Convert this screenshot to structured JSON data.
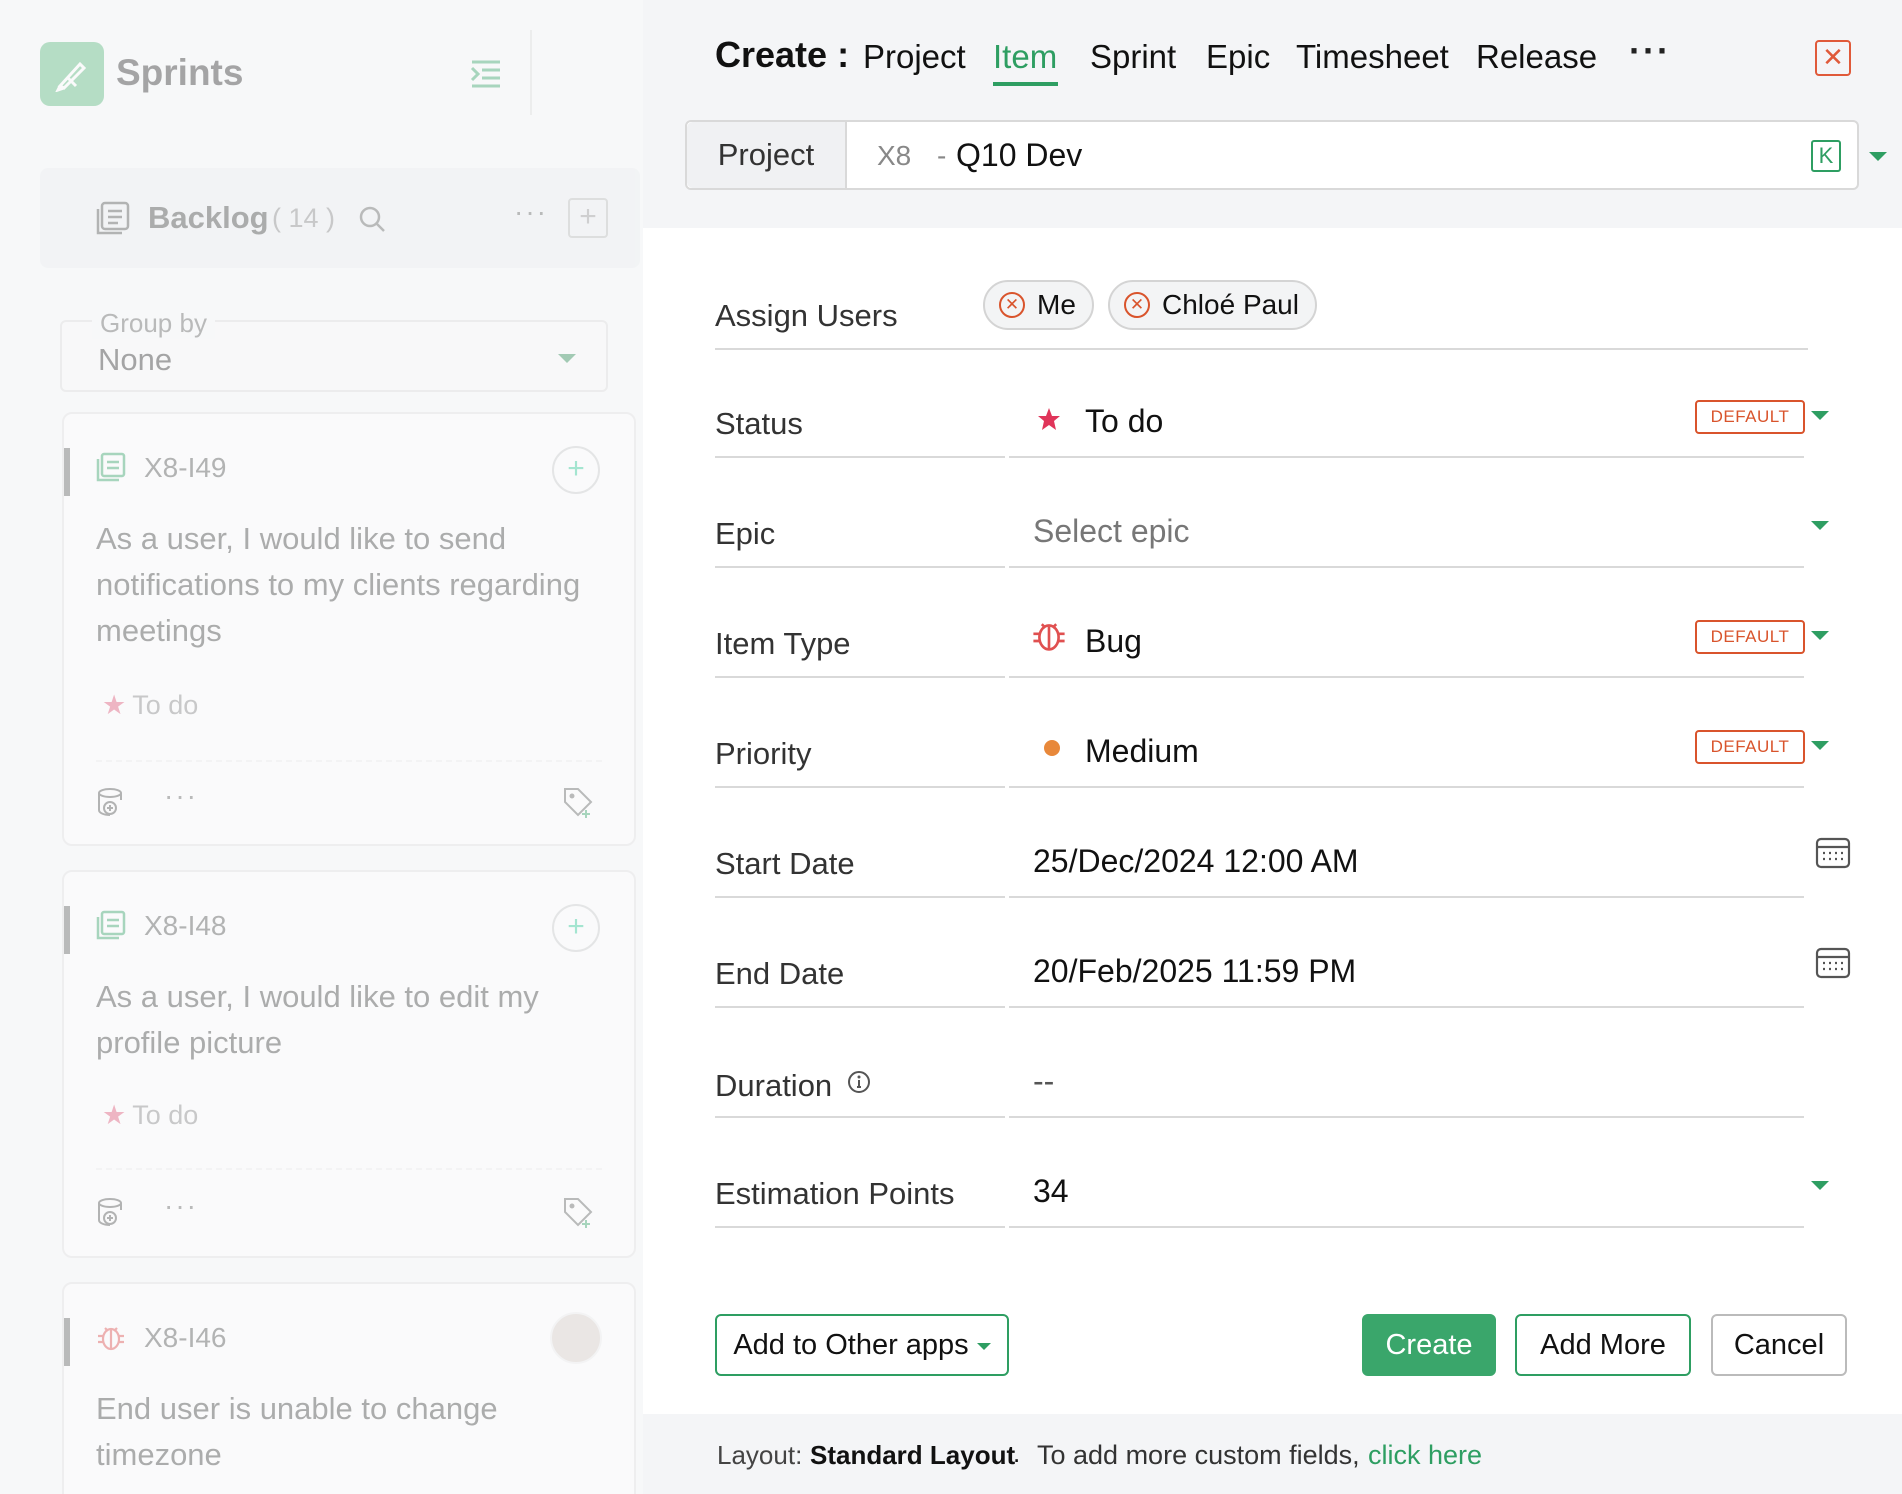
{
  "sidebar": {
    "title": "Sprints",
    "backlog": {
      "title": "Backlog",
      "count": "( 14 )",
      "more": "···",
      "add": "+"
    },
    "group_by": {
      "label": "Group by",
      "value": "None"
    },
    "cards": [
      {
        "id": "X8-I49",
        "text": "As a user, I would like to send notifications to my clients regarding meetings",
        "status": "To do",
        "more": "···"
      },
      {
        "id": "X8-I48",
        "text": "As a user, I would like to edit my profile picture",
        "status": "To do",
        "more": "···"
      },
      {
        "id": "X8-I46",
        "text": "End user is unable to change timezone"
      }
    ]
  },
  "panel": {
    "create_label": "Create :",
    "tabs": [
      "Project",
      "Item",
      "Sprint",
      "Epic",
      "Timesheet",
      "Release"
    ],
    "active_tab": "Item",
    "more": "···",
    "close": "✕",
    "project": {
      "label": "Project",
      "code": "X8",
      "dash": "-",
      "name": "Q10 Dev",
      "k_badge": "K"
    },
    "fields": {
      "assign_users": {
        "label": "Assign Users",
        "users": [
          "Me",
          "Chloé Paul"
        ]
      },
      "status": {
        "label": "Status",
        "value": "To do",
        "badge": "DEFAULT",
        "color": "#e0355a"
      },
      "epic": {
        "label": "Epic",
        "placeholder": "Select epic"
      },
      "item_type": {
        "label": "Item Type",
        "value": "Bug",
        "badge": "DEFAULT",
        "color": "#e05050"
      },
      "priority": {
        "label": "Priority",
        "value": "Medium",
        "badge": "DEFAULT",
        "color": "#e8883a"
      },
      "start_date": {
        "label": "Start Date",
        "value": "25/Dec/2024 12:00 AM"
      },
      "end_date": {
        "label": "End Date",
        "value": "20/Feb/2025 11:59 PM"
      },
      "duration": {
        "label": "Duration",
        "value": "--"
      },
      "estimation_points": {
        "label": "Estimation Points",
        "value": "34"
      }
    },
    "buttons": {
      "add_other_apps": "Add to Other apps",
      "create": "Create",
      "add_more": "Add More",
      "cancel": "Cancel"
    },
    "footer": {
      "layout_label": "Layout:",
      "layout_value": "Standard Layout",
      "dot": ".",
      "text": "To add more custom fields,",
      "link": "click here"
    }
  },
  "colors": {
    "accent": "#2e9e62",
    "danger": "#d9542c"
  }
}
